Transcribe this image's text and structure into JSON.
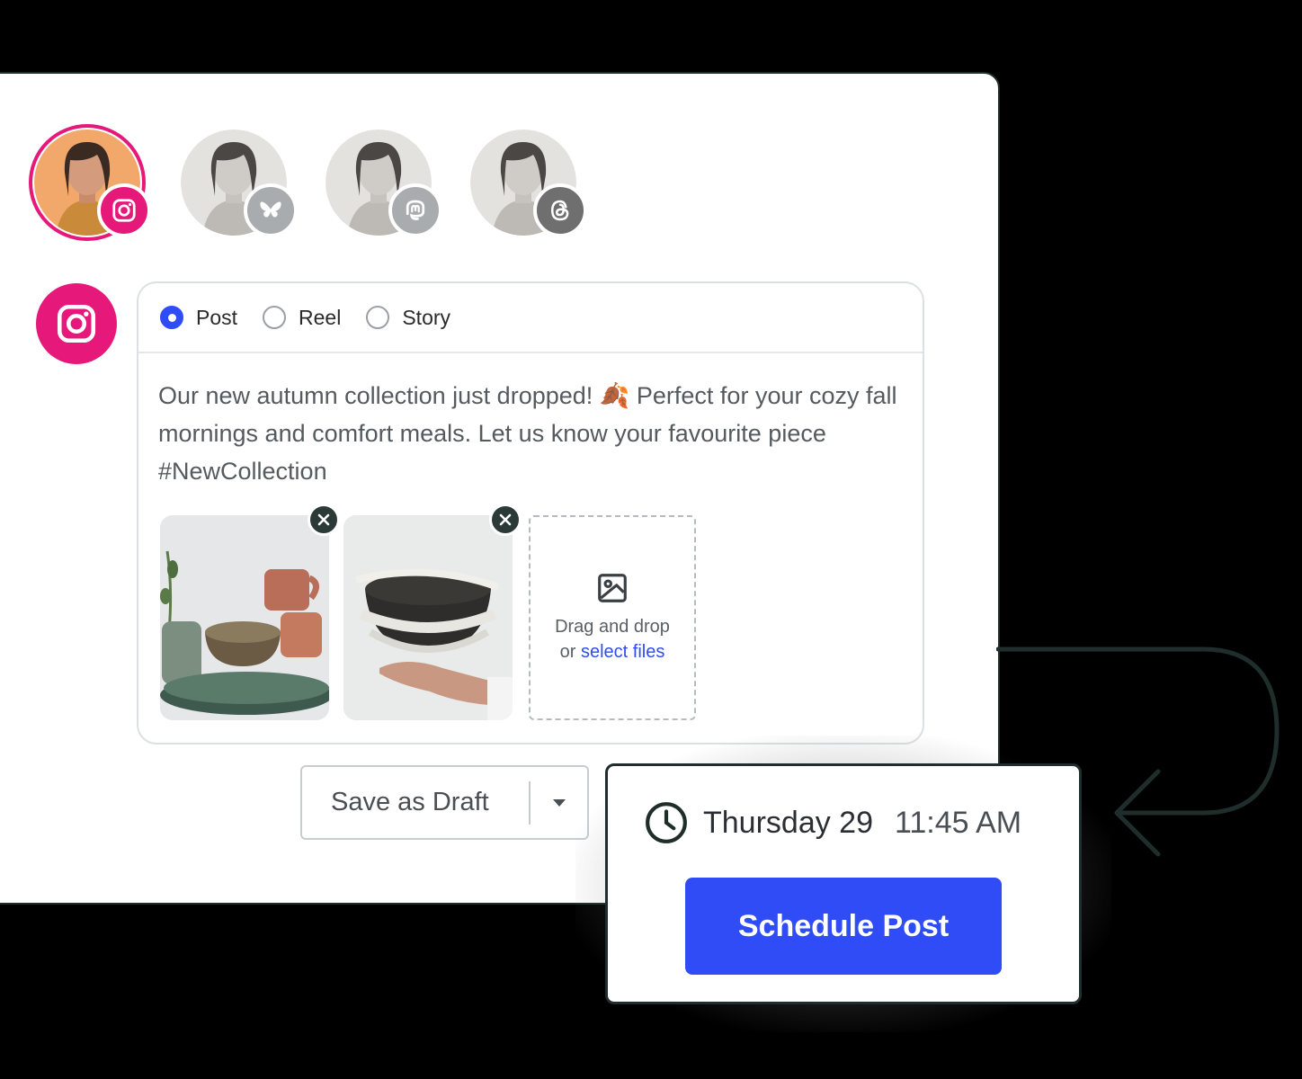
{
  "accounts": [
    {
      "network": "instagram",
      "icon": "instagram-icon",
      "active": true,
      "badge_color": "#e6187a"
    },
    {
      "network": "bluesky",
      "icon": "butterfly-icon",
      "active": false,
      "badge_color": "#a9acaf"
    },
    {
      "network": "mastodon",
      "icon": "mastodon-icon",
      "active": false,
      "badge_color": "#a9acaf"
    },
    {
      "network": "threads",
      "icon": "threads-icon",
      "active": false,
      "badge_color": "#6f6f6f"
    }
  ],
  "composer": {
    "network_icon": "instagram-icon",
    "post_types": [
      {
        "label": "Post",
        "checked": true
      },
      {
        "label": "Reel",
        "checked": false
      },
      {
        "label": "Story",
        "checked": false
      }
    ],
    "text": "Our new autumn collection just dropped! 🍂 Perfect for your cozy fall mornings and comfort meals. Let us know your favourite piece #NewCollection",
    "media": [
      {
        "alt": "ceramic mugs and bowls on green plate"
      },
      {
        "alt": "hand holding stacked ceramic bowls"
      }
    ],
    "dropzone": {
      "line1": "Drag and drop",
      "line2_prefix": "or ",
      "link": "select files"
    }
  },
  "draft": {
    "label": "Save as Draft"
  },
  "schedule": {
    "day": "Thursday 29",
    "time": "11:45 AM",
    "button": "Schedule Post"
  },
  "colors": {
    "brand_pink": "#e6187a",
    "primary_blue": "#2f4cf6",
    "dark": "#1f2e2a"
  }
}
